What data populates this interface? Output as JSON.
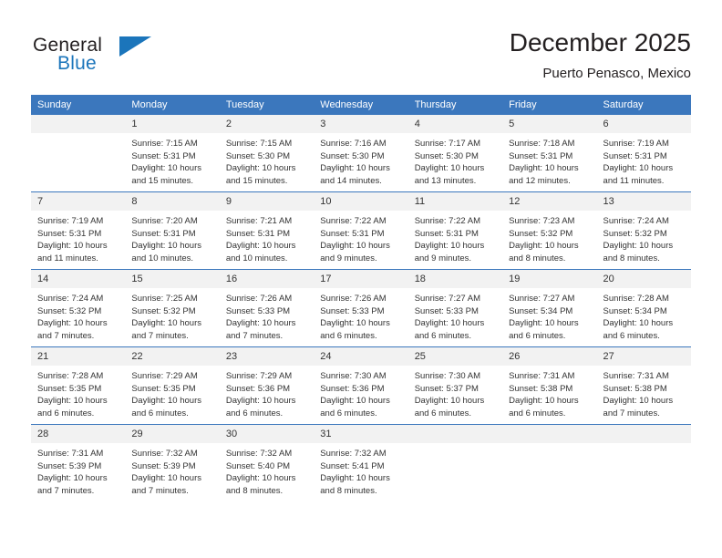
{
  "brand": {
    "name_part1": "General",
    "name_part2": "Blue",
    "flag_icon": "triangle-flag-icon"
  },
  "header": {
    "title": "December 2025",
    "subtitle": "Puerto Penasco, Mexico"
  },
  "labels": {
    "sunrise_prefix": "Sunrise:",
    "sunset_prefix": "Sunset:",
    "daylight_prefix": "Daylight:"
  },
  "colors": {
    "header_blue": "#3b77bd",
    "brand_blue": "#1b75bb",
    "daynum_bg": "#f2f2f2",
    "text": "#333333"
  },
  "weekdays": [
    "Sunday",
    "Monday",
    "Tuesday",
    "Wednesday",
    "Thursday",
    "Friday",
    "Saturday"
  ],
  "weeks": [
    [
      {
        "day": "",
        "sunrise": "",
        "sunset": "",
        "daylight_line1": "",
        "daylight_line2": "",
        "blank": true
      },
      {
        "day": "1",
        "sunrise": "Sunrise: 7:15 AM",
        "sunset": "Sunset: 5:31 PM",
        "daylight_line1": "Daylight: 10 hours",
        "daylight_line2": "and 15 minutes.",
        "blank": false
      },
      {
        "day": "2",
        "sunrise": "Sunrise: 7:15 AM",
        "sunset": "Sunset: 5:30 PM",
        "daylight_line1": "Daylight: 10 hours",
        "daylight_line2": "and 15 minutes.",
        "blank": false
      },
      {
        "day": "3",
        "sunrise": "Sunrise: 7:16 AM",
        "sunset": "Sunset: 5:30 PM",
        "daylight_line1": "Daylight: 10 hours",
        "daylight_line2": "and 14 minutes.",
        "blank": false
      },
      {
        "day": "4",
        "sunrise": "Sunrise: 7:17 AM",
        "sunset": "Sunset: 5:30 PM",
        "daylight_line1": "Daylight: 10 hours",
        "daylight_line2": "and 13 minutes.",
        "blank": false
      },
      {
        "day": "5",
        "sunrise": "Sunrise: 7:18 AM",
        "sunset": "Sunset: 5:31 PM",
        "daylight_line1": "Daylight: 10 hours",
        "daylight_line2": "and 12 minutes.",
        "blank": false
      },
      {
        "day": "6",
        "sunrise": "Sunrise: 7:19 AM",
        "sunset": "Sunset: 5:31 PM",
        "daylight_line1": "Daylight: 10 hours",
        "daylight_line2": "and 11 minutes.",
        "blank": false
      }
    ],
    [
      {
        "day": "7",
        "sunrise": "Sunrise: 7:19 AM",
        "sunset": "Sunset: 5:31 PM",
        "daylight_line1": "Daylight: 10 hours",
        "daylight_line2": "and 11 minutes.",
        "blank": false
      },
      {
        "day": "8",
        "sunrise": "Sunrise: 7:20 AM",
        "sunset": "Sunset: 5:31 PM",
        "daylight_line1": "Daylight: 10 hours",
        "daylight_line2": "and 10 minutes.",
        "blank": false
      },
      {
        "day": "9",
        "sunrise": "Sunrise: 7:21 AM",
        "sunset": "Sunset: 5:31 PM",
        "daylight_line1": "Daylight: 10 hours",
        "daylight_line2": "and 10 minutes.",
        "blank": false
      },
      {
        "day": "10",
        "sunrise": "Sunrise: 7:22 AM",
        "sunset": "Sunset: 5:31 PM",
        "daylight_line1": "Daylight: 10 hours",
        "daylight_line2": "and 9 minutes.",
        "blank": false
      },
      {
        "day": "11",
        "sunrise": "Sunrise: 7:22 AM",
        "sunset": "Sunset: 5:31 PM",
        "daylight_line1": "Daylight: 10 hours",
        "daylight_line2": "and 9 minutes.",
        "blank": false
      },
      {
        "day": "12",
        "sunrise": "Sunrise: 7:23 AM",
        "sunset": "Sunset: 5:32 PM",
        "daylight_line1": "Daylight: 10 hours",
        "daylight_line2": "and 8 minutes.",
        "blank": false
      },
      {
        "day": "13",
        "sunrise": "Sunrise: 7:24 AM",
        "sunset": "Sunset: 5:32 PM",
        "daylight_line1": "Daylight: 10 hours",
        "daylight_line2": "and 8 minutes.",
        "blank": false
      }
    ],
    [
      {
        "day": "14",
        "sunrise": "Sunrise: 7:24 AM",
        "sunset": "Sunset: 5:32 PM",
        "daylight_line1": "Daylight: 10 hours",
        "daylight_line2": "and 7 minutes.",
        "blank": false
      },
      {
        "day": "15",
        "sunrise": "Sunrise: 7:25 AM",
        "sunset": "Sunset: 5:32 PM",
        "daylight_line1": "Daylight: 10 hours",
        "daylight_line2": "and 7 minutes.",
        "blank": false
      },
      {
        "day": "16",
        "sunrise": "Sunrise: 7:26 AM",
        "sunset": "Sunset: 5:33 PM",
        "daylight_line1": "Daylight: 10 hours",
        "daylight_line2": "and 7 minutes.",
        "blank": false
      },
      {
        "day": "17",
        "sunrise": "Sunrise: 7:26 AM",
        "sunset": "Sunset: 5:33 PM",
        "daylight_line1": "Daylight: 10 hours",
        "daylight_line2": "and 6 minutes.",
        "blank": false
      },
      {
        "day": "18",
        "sunrise": "Sunrise: 7:27 AM",
        "sunset": "Sunset: 5:33 PM",
        "daylight_line1": "Daylight: 10 hours",
        "daylight_line2": "and 6 minutes.",
        "blank": false
      },
      {
        "day": "19",
        "sunrise": "Sunrise: 7:27 AM",
        "sunset": "Sunset: 5:34 PM",
        "daylight_line1": "Daylight: 10 hours",
        "daylight_line2": "and 6 minutes.",
        "blank": false
      },
      {
        "day": "20",
        "sunrise": "Sunrise: 7:28 AM",
        "sunset": "Sunset: 5:34 PM",
        "daylight_line1": "Daylight: 10 hours",
        "daylight_line2": "and 6 minutes.",
        "blank": false
      }
    ],
    [
      {
        "day": "21",
        "sunrise": "Sunrise: 7:28 AM",
        "sunset": "Sunset: 5:35 PM",
        "daylight_line1": "Daylight: 10 hours",
        "daylight_line2": "and 6 minutes.",
        "blank": false
      },
      {
        "day": "22",
        "sunrise": "Sunrise: 7:29 AM",
        "sunset": "Sunset: 5:35 PM",
        "daylight_line1": "Daylight: 10 hours",
        "daylight_line2": "and 6 minutes.",
        "blank": false
      },
      {
        "day": "23",
        "sunrise": "Sunrise: 7:29 AM",
        "sunset": "Sunset: 5:36 PM",
        "daylight_line1": "Daylight: 10 hours",
        "daylight_line2": "and 6 minutes.",
        "blank": false
      },
      {
        "day": "24",
        "sunrise": "Sunrise: 7:30 AM",
        "sunset": "Sunset: 5:36 PM",
        "daylight_line1": "Daylight: 10 hours",
        "daylight_line2": "and 6 minutes.",
        "blank": false
      },
      {
        "day": "25",
        "sunrise": "Sunrise: 7:30 AM",
        "sunset": "Sunset: 5:37 PM",
        "daylight_line1": "Daylight: 10 hours",
        "daylight_line2": "and 6 minutes.",
        "blank": false
      },
      {
        "day": "26",
        "sunrise": "Sunrise: 7:31 AM",
        "sunset": "Sunset: 5:38 PM",
        "daylight_line1": "Daylight: 10 hours",
        "daylight_line2": "and 6 minutes.",
        "blank": false
      },
      {
        "day": "27",
        "sunrise": "Sunrise: 7:31 AM",
        "sunset": "Sunset: 5:38 PM",
        "daylight_line1": "Daylight: 10 hours",
        "daylight_line2": "and 7 minutes.",
        "blank": false
      }
    ],
    [
      {
        "day": "28",
        "sunrise": "Sunrise: 7:31 AM",
        "sunset": "Sunset: 5:39 PM",
        "daylight_line1": "Daylight: 10 hours",
        "daylight_line2": "and 7 minutes.",
        "blank": false
      },
      {
        "day": "29",
        "sunrise": "Sunrise: 7:32 AM",
        "sunset": "Sunset: 5:39 PM",
        "daylight_line1": "Daylight: 10 hours",
        "daylight_line2": "and 7 minutes.",
        "blank": false
      },
      {
        "day": "30",
        "sunrise": "Sunrise: 7:32 AM",
        "sunset": "Sunset: 5:40 PM",
        "daylight_line1": "Daylight: 10 hours",
        "daylight_line2": "and 8 minutes.",
        "blank": false
      },
      {
        "day": "31",
        "sunrise": "Sunrise: 7:32 AM",
        "sunset": "Sunset: 5:41 PM",
        "daylight_line1": "Daylight: 10 hours",
        "daylight_line2": "and 8 minutes.",
        "blank": false
      },
      {
        "day": "",
        "sunrise": "",
        "sunset": "",
        "daylight_line1": "",
        "daylight_line2": "",
        "blank": true
      },
      {
        "day": "",
        "sunrise": "",
        "sunset": "",
        "daylight_line1": "",
        "daylight_line2": "",
        "blank": true
      },
      {
        "day": "",
        "sunrise": "",
        "sunset": "",
        "daylight_line1": "",
        "daylight_line2": "",
        "blank": true
      }
    ]
  ]
}
